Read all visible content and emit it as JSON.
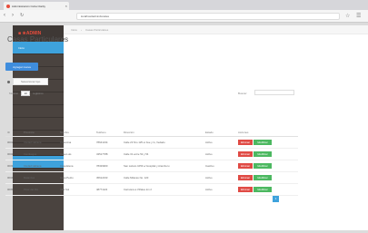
{
  "browser": {
    "tab_title": "Administración Cuba Clarity",
    "tab_close": "×",
    "address": "localhost/admin/locales",
    "back": "‹",
    "forward": "›",
    "reload": "↻",
    "ext_icons": [
      "☆",
      "☰"
    ]
  },
  "sidebar": {
    "logo": "■ ★ADMIN",
    "items": [
      {
        "label": "Inicio",
        "active": true
      },
      {
        "label": ""
      },
      {
        "label": ""
      },
      {
        "label": ""
      },
      {
        "label": ""
      },
      {
        "label": ""
      },
      {
        "label": ""
      },
      {
        "label": ""
      },
      {
        "label": ""
      },
      {
        "label": "",
        "active": true
      }
    ]
  },
  "main": {
    "breadcrumb": [
      "Inicio",
      "Casas Particulares"
    ],
    "title": "Casas Particulares",
    "new_button": "Agregar nueva",
    "filter_label": "Seleccionar tipo",
    "show_label": "Mostrar",
    "show_count": "10",
    "show_suffix": "registros",
    "search_label": "Buscar:",
    "columns": [
      "ID",
      "Provincia",
      "Nombre",
      "Teléfono",
      "Dirección",
      "Estado",
      "Acciones"
    ],
    "rows": [
      {
        "id": "0001",
        "prov": "Ciudad Habana",
        "name": "Casa Ana",
        "tel": "78641234",
        "dir": "Calle 23 Nro 125 e/ Ave y G, Vedado",
        "estado": "Activo"
      },
      {
        "id": "0002",
        "prov": "Cienfuegos",
        "name": "Casa Luis",
        "tel": "43517788",
        "dir": "Calle 31 entre 52 y 54",
        "estado": "Activo"
      },
      {
        "id": "0003",
        "prov": "Ciudad Habana",
        "name": "Casa Elena",
        "tel": "78329900",
        "dir": "San Lázaro 1053 e/ Hospital y Aramburu",
        "estado": "Inactivo"
      },
      {
        "id": "0004",
        "prov": "Matanzas",
        "name": "Casa Pedro",
        "tel": "45612233",
        "dir": "Calle Milanés No. 120",
        "estado": "Activo"
      },
      {
        "id": "0005",
        "prov": "Pinar del Río",
        "name": "Villa Sol",
        "tel": "48771122",
        "dir": "Carretera a Viñales km 2",
        "estado": "Activo"
      }
    ],
    "del_label": "Eliminar",
    "edit_label": "Modificar",
    "page": "1"
  },
  "colors": {
    "sidebar_bg": "#4a433f",
    "accent": "#3ea2dc",
    "danger": "#e04b45",
    "success": "#4cb860"
  }
}
